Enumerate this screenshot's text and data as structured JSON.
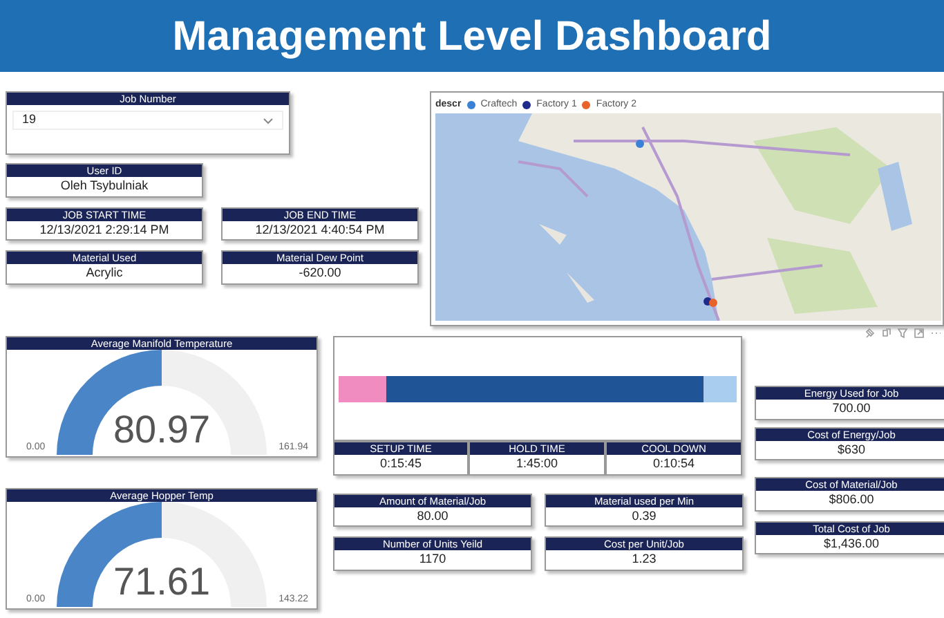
{
  "title": "Management Level Dashboard",
  "job_number": {
    "label": "Job Number",
    "value": "19"
  },
  "user_id": {
    "label": "User ID",
    "value": "Oleh Tsybulniak"
  },
  "job_times": [
    {
      "label": "JOB START TIME",
      "value": "12/13/2021 2:29:14 PM"
    },
    {
      "label": "JOB END TIME",
      "value": "12/13/2021 4:40:54 PM"
    }
  ],
  "material": [
    {
      "label": "Material Used",
      "value": "Acrylic"
    },
    {
      "label": "Material Dew Point",
      "value": "-620.00"
    }
  ],
  "map": {
    "legend_title": "descr",
    "legend": [
      {
        "name": "Craftech",
        "color": "#3b82d6"
      },
      {
        "name": "Factory 1",
        "color": "#1f2a8a"
      },
      {
        "name": "Factory 2",
        "color": "#e8622a"
      }
    ]
  },
  "gauges": [
    {
      "label": "Average Manifold Temperature",
      "value": "80.97",
      "min": "0.00",
      "max": "161.94",
      "level": 0.5
    },
    {
      "label": "Average Hopper Temp",
      "value": "71.61",
      "min": "0.00",
      "max": "143.22",
      "level": 0.5
    }
  ],
  "phases": [
    {
      "label": "SETUP TIME",
      "value": "0:15:45",
      "color": "#f08cbf"
    },
    {
      "label": "HOLD TIME",
      "value": "1:45:00",
      "color": "#1f5596"
    },
    {
      "label": "COOL DOWN",
      "value": "0:10:54",
      "color": "#a9cdee"
    }
  ],
  "middle_kpis": [
    [
      {
        "label": "Amount of Material/Job",
        "value": "80.00"
      },
      {
        "label": "Material used per Min",
        "value": "0.39"
      }
    ],
    [
      {
        "label": "Number of Units Yeild",
        "value": "1170"
      },
      {
        "label": "Cost per Unit/Job",
        "value": "1.23"
      }
    ]
  ],
  "right_kpis": [
    {
      "label": "Energy Used for Job",
      "value": "700.00"
    },
    {
      "label": "Cost of Energy/Job",
      "value": "$630"
    },
    {
      "label": "Cost of Material/Job",
      "value": "$806.00"
    },
    {
      "label": "Total Cost of Job",
      "value": "$1,436.00"
    }
  ]
}
